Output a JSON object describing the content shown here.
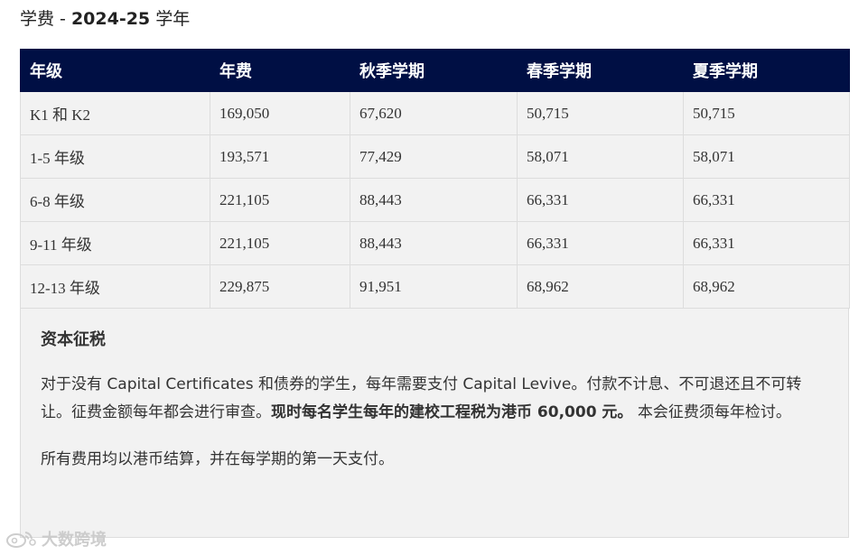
{
  "heading": {
    "label": "学费 - ",
    "year": "2024-25",
    "suffix": " 学年"
  },
  "table": {
    "headers": [
      "年级",
      "年费",
      "秋季学期",
      "春季学期",
      "夏季学期"
    ],
    "rows": [
      [
        "K1 和 K2",
        "169,050",
        "67,620",
        "50,715",
        "50,715"
      ],
      [
        "1-5 年级",
        "193,571",
        "77,429",
        "58,071",
        "58,071"
      ],
      [
        "6-8 年级",
        "221,105",
        "88,443",
        "66,331",
        "66,331"
      ],
      [
        "9-11 年级",
        "221,105",
        "88,443",
        "66,331",
        "66,331"
      ],
      [
        "12-13 年级",
        "229,875",
        "91,951",
        "68,962",
        "68,962"
      ]
    ]
  },
  "notes": {
    "title": "资本征税",
    "para1_a": "对于没有 Capital Certificates 和债券的学生，每年需要支付 Capital Levive。付款不计息、不可退还且不可转让。征费金额每年都会进行审查。",
    "para1_bold": "现时每名学生每年的建校工程税为港币 60,000 元。",
    "para1_b": " 本会征费须每年检讨。",
    "para2": "所有费用均以港币结算，并在每学期的第一天支付。"
  },
  "watermark": {
    "text": "大数跨境",
    "logo_icon": "weibo-logo-icon"
  },
  "colors": {
    "header_bg": "#000f44",
    "row_bg": "#f2f2f2",
    "border": "#dddddd"
  }
}
